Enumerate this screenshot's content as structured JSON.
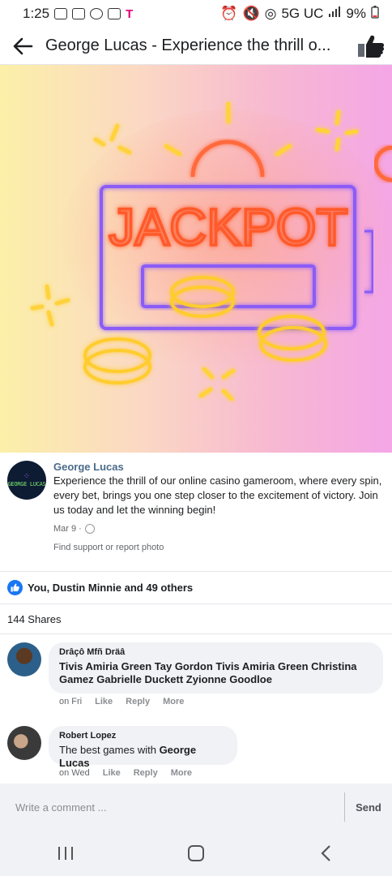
{
  "status_bar": {
    "time": "1:25",
    "network": "5G UC",
    "battery": "9%",
    "carrier_glyph": "T"
  },
  "header": {
    "title": "George Lucas - Experience the thrill o..."
  },
  "photo": {
    "sign_text": "JACKPOT"
  },
  "post": {
    "author": "George Lucas",
    "avatar_text": "GEORGE LUCAS",
    "text": "Experience the thrill of our online casino gameroom, where every spin, every bet, brings you one step closer to the excitement of victory. Join us today and let the winning begin!",
    "date": "Mar 9 ·",
    "report_link": "Find support or report photo"
  },
  "reactions": {
    "text": "You, Dustin Minnie and 49 others"
  },
  "shares": {
    "text": "144 Shares"
  },
  "comments": [
    {
      "name": "Drâçô Mfñ Dräâ",
      "text": "Tivis Amiria Green Tay Gordon Tivis Amiria Green Christina Gamez Gabrielle Duckett Zyionne Goodloe",
      "time": "on Fri",
      "like": "Like",
      "reply": "Reply",
      "more": "More"
    },
    {
      "name": "Robert Lopez",
      "text_prefix": "The best games with ",
      "text_bold": "George Lucas",
      "time": "on Wed",
      "like": "Like",
      "reply": "Reply",
      "more": "More"
    }
  ],
  "composer": {
    "placeholder": "Write a comment ...",
    "send": "Send"
  },
  "colors": {
    "accent": "#1877f2",
    "muted": "#65676b",
    "bubble": "#f0f2f5"
  }
}
